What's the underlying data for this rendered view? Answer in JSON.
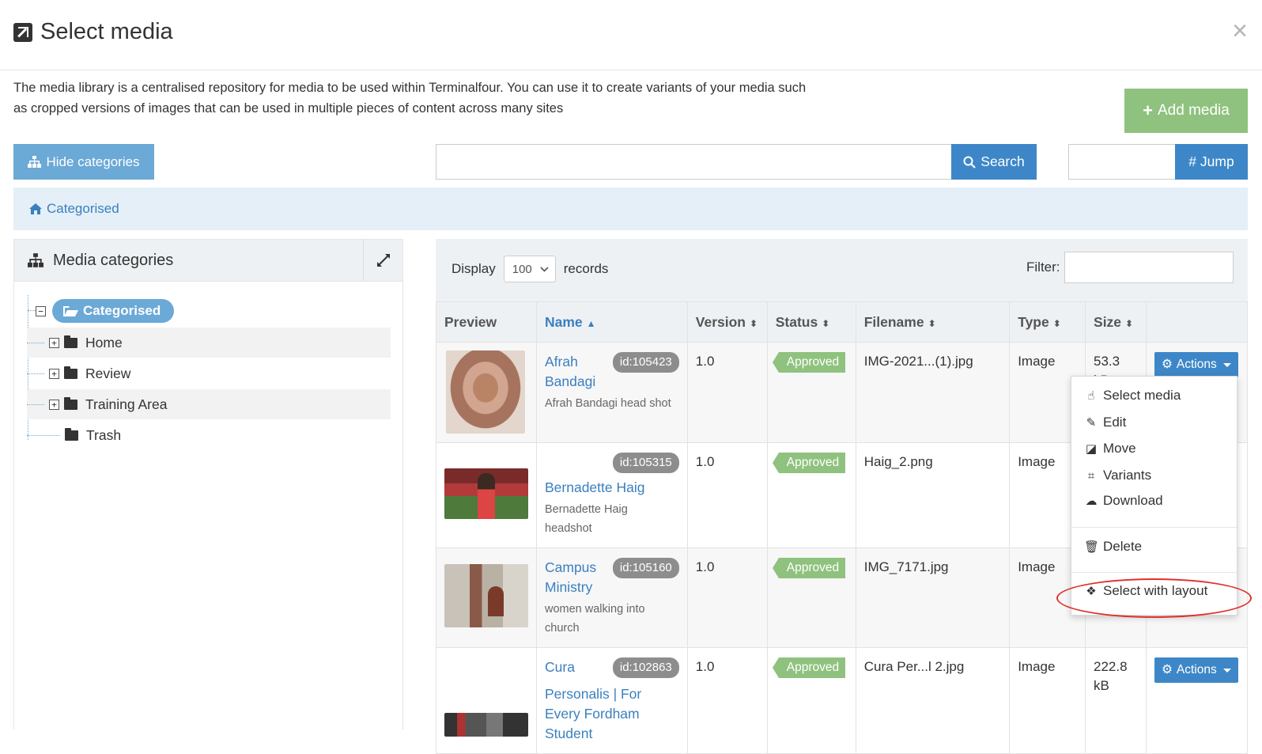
{
  "header": {
    "title": "Select media",
    "close_glyph": "×"
  },
  "intro": "The media library is a centralised repository for media to be used within Terminalfour. You can use it to create variants of your media such as cropped versions of images that can be used in multiple pieces of content across many sites",
  "toolbar": {
    "add_label": "Add media",
    "hide_categories_label": "Hide categories",
    "search_placeholder": "",
    "search_label": "Search",
    "jump_placeholder": "",
    "jump_label": "# Jump"
  },
  "breadcrumb": {
    "label": "Categorised"
  },
  "categories": {
    "title": "Media categories",
    "root": "Categorised",
    "items": [
      {
        "label": "Home",
        "expandable": true
      },
      {
        "label": "Review",
        "expandable": true
      },
      {
        "label": "Training Area",
        "expandable": true
      },
      {
        "label": "Trash",
        "expandable": false
      }
    ]
  },
  "table_controls": {
    "display_label": "Display",
    "records_value": "100",
    "records_label": "records",
    "filter_label": "Filter:"
  },
  "columns": [
    "Preview",
    "Name",
    "Version",
    "Status",
    "Filename",
    "Type",
    "Size",
    ""
  ],
  "rows": [
    {
      "name_line1": "Afrah",
      "name_line2": "Bandagi",
      "id": "id:105423",
      "description": "Afrah Bandagi head shot",
      "version": "1.0",
      "status": "Approved",
      "filename": "IMG-2021...(1).jpg",
      "type": "Image",
      "size": "53.3",
      "size_unit": "kB",
      "actions_label": "Actions"
    },
    {
      "name_line1": "Bernadette Haig",
      "name_line2": "",
      "id": "id:105315",
      "description": "Bernadette Haig headshot",
      "version": "1.0",
      "status": "Approved",
      "filename": "Haig_2.png",
      "type": "Image",
      "size": "",
      "size_unit": "",
      "actions_label": "Actions"
    },
    {
      "name_line1": "Campus",
      "name_line2": "Ministry",
      "id": "id:105160",
      "description": "women walking into church",
      "version": "1.0",
      "status": "Approved",
      "filename": "IMG_7171.jpg",
      "type": "Image",
      "size": "",
      "size_unit": "",
      "actions_label": "Actions"
    },
    {
      "name_line1": "Cura",
      "name_line2": "Personalis | For Every Fordham Student",
      "id": "id:102863",
      "description": "",
      "version": "1.0",
      "status": "Approved",
      "filename": "Cura Per...l 2.jpg",
      "type": "Image",
      "size": "222.8",
      "size_unit": "kB",
      "actions_label": "Actions"
    }
  ],
  "actions_menu": {
    "items": [
      "Select media",
      "Edit",
      "Move",
      "Variants",
      "Download"
    ],
    "delete": "Delete",
    "select_with_layout": "Select with layout"
  },
  "colors": {
    "primary": "#3d87c8",
    "add": "#8fc27e",
    "light_blue": "#6ba9d6",
    "highlight_ring": "#e0302a"
  }
}
